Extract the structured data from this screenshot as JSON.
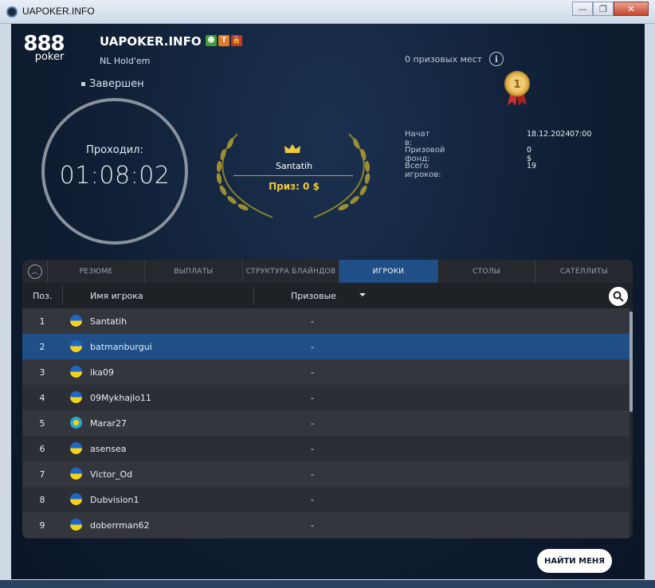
{
  "window": {
    "title": "UAPOKER.INFO",
    "min": "—",
    "max": "❐",
    "close": "✕"
  },
  "header": {
    "logo_num": "888",
    "logo_word": "poker",
    "tournament_title": "UAPOKER.INFO",
    "badges": [
      "☻",
      "T",
      "🔒"
    ],
    "game": "NL Hold'em",
    "status": "Завершен",
    "prize_places": "0 призовых мест",
    "info": "i",
    "medal_rank": "1"
  },
  "clock": {
    "label": "Проходил:",
    "time": "01:08:02"
  },
  "winner": {
    "name": "Santatih",
    "prize": "Приз: 0 $"
  },
  "details": {
    "started_label": "Начат в:",
    "started_date": "18.12.2024",
    "started_time": "07:00",
    "prize_pool_label": "Призовой фонд:",
    "prize_pool": "0 $",
    "players_label": "Всего игроков:",
    "players": "19"
  },
  "tabs": [
    "РЕЗЮМЕ",
    "ВЫПЛАТЫ",
    "СТРУКТУРА БЛАЙНДОВ",
    "ИГРОКИ",
    "СТОЛЫ",
    "САТЕЛЛИТЫ"
  ],
  "active_tab": "ИГРОКИ",
  "table": {
    "headers": {
      "pos": "Поз.",
      "name": "Имя игрока",
      "prize": "Призовые"
    },
    "rows": [
      {
        "pos": "1",
        "name": "Santatih",
        "prize": "-"
      },
      {
        "pos": "2",
        "name": "batmanburgui",
        "prize": "-"
      },
      {
        "pos": "3",
        "name": "ika09",
        "prize": "-"
      },
      {
        "pos": "4",
        "name": "09Mykhajlo11",
        "prize": "-"
      },
      {
        "pos": "5",
        "name": "Marar27",
        "prize": "-"
      },
      {
        "pos": "6",
        "name": "asensea",
        "prize": "-"
      },
      {
        "pos": "7",
        "name": "Victor_Od",
        "prize": "-"
      },
      {
        "pos": "8",
        "name": "Dubvision1",
        "prize": "-"
      },
      {
        "pos": "9",
        "name": "doberrman62",
        "prize": "-"
      }
    ]
  },
  "find_me": "НАЙТИ МЕНЯ",
  "colors": {
    "accent": "#1f4f86",
    "gold": "#f0c83a",
    "background": "#0f1e33"
  }
}
